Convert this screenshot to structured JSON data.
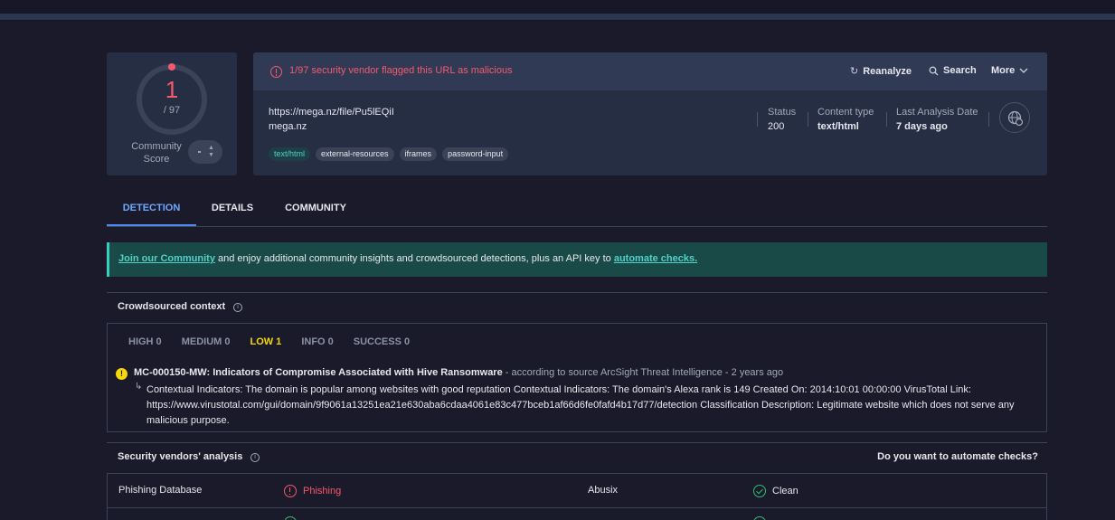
{
  "score": {
    "value": "1",
    "total": "/ 97",
    "community_label": "Community Score",
    "community_value": "-"
  },
  "header": {
    "flag_text": "1/97 security vendor flagged this URL as malicious",
    "reanalyze": "Reanalyze",
    "search": "Search",
    "more": "More"
  },
  "url": {
    "full": "https://mega.nz/file/Pu5lEQiI",
    "domain": "mega.nz",
    "tags": [
      "text/html",
      "external-resources",
      "iframes",
      "password-input"
    ]
  },
  "meta": {
    "status_label": "Status",
    "status_value": "200",
    "content_type_label": "Content type",
    "content_type_value": "text/html",
    "last_analysis_label": "Last Analysis Date",
    "last_analysis_value": "7 days ago"
  },
  "tabs": [
    "DETECTION",
    "DETAILS",
    "COMMUNITY"
  ],
  "banner": {
    "link1": "Join our Community",
    "middle": " and enjoy additional community insights and crowdsourced detections, plus an API key to ",
    "link2": "automate checks."
  },
  "crowdsourced": {
    "title": "Crowdsourced context",
    "filters": [
      "HIGH 0",
      "MEDIUM 0",
      "LOW 1",
      "INFO 0",
      "SUCCESS 0"
    ],
    "alert_title": "MC-000150-MW: Indicators of Compromise Associated with Hive Ransomware",
    "alert_source": " - according to source ArcSight Threat Intelligence - 2 years ago",
    "alert_desc": "Contextual Indicators: The domain is popular among websites with good reputation Contextual Indicators: The domain's Alexa rank is 149 Created On: 2014:10:01 00:00:00 VirusTotal Link: https://www.virustotal.com/gui/domain/9f9061a13251ea21e630aba6cdaa4061e83c477bceb1af66d6fe0fafd4b17d77/detection Classification Description: Legitimate website which does not serve any malicious purpose."
  },
  "vendors": {
    "title": "Security vendors' analysis",
    "automate_question": "Do you want to automate checks?",
    "rows": [
      {
        "name1": "Phishing Database",
        "result1": "Phishing",
        "name2": "Abusix",
        "result2": "Clean"
      }
    ]
  },
  "colors": {
    "malicious": "#f4596d",
    "clean": "#2fbf71",
    "accent": "#4d8df5",
    "low": "#f5d90a"
  }
}
